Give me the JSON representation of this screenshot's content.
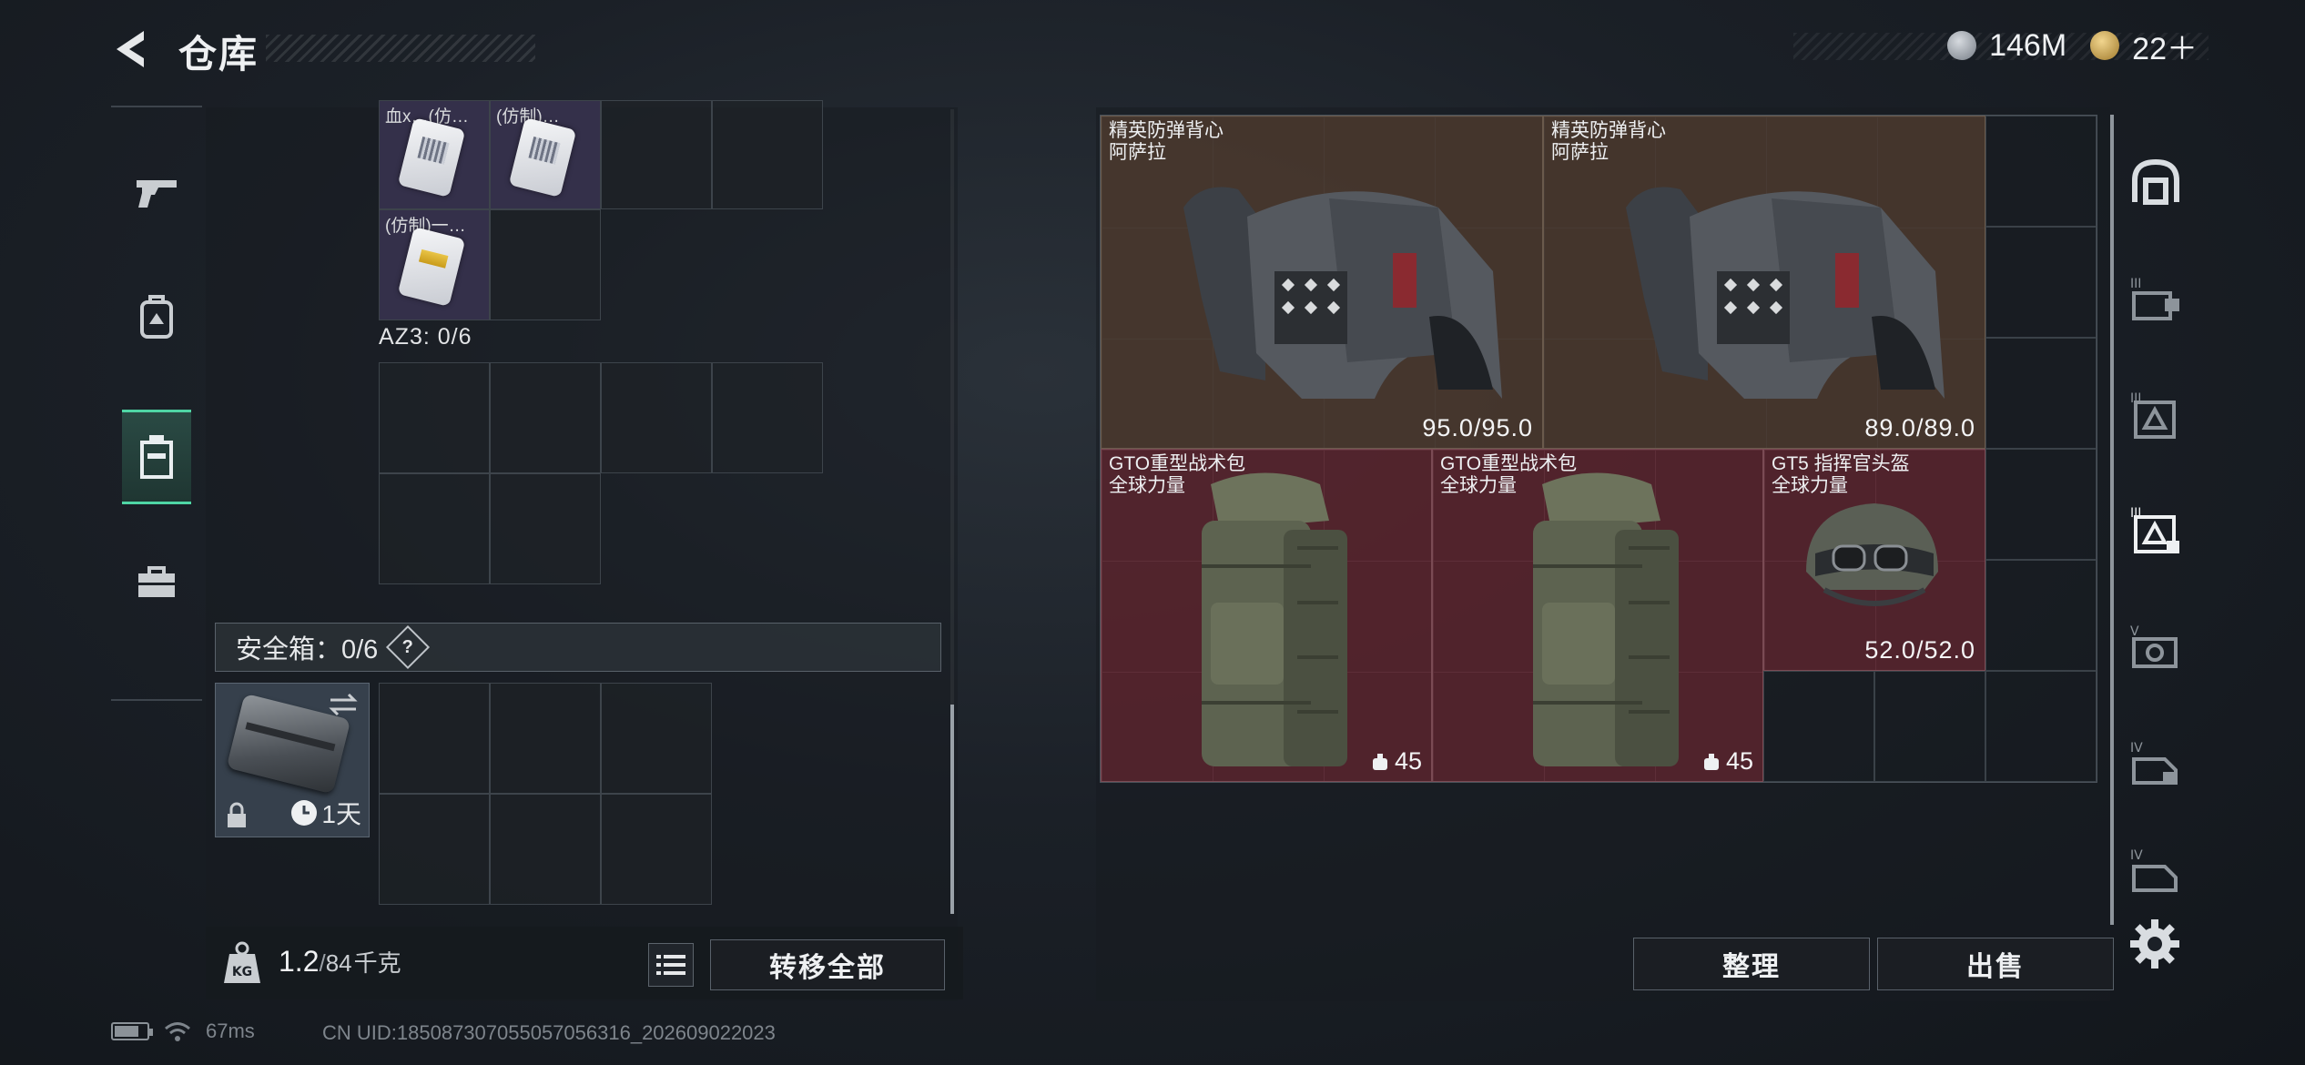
{
  "header": {
    "title": "仓库",
    "currency": [
      {
        "icon": "silver-coin-icon",
        "value": "146M"
      },
      {
        "icon": "gold-coin-icon",
        "value": "22＋"
      }
    ]
  },
  "left_nav": [
    "weapon-pistol-icon",
    "backpack-icon",
    "chest-rig-icon",
    "toolbox-icon"
  ],
  "backpack": {
    "top_items": [
      {
        "label": "血x…(仿…"
      },
      {
        "label": "(仿制)…"
      },
      {
        "label": "(仿制)一…"
      }
    ],
    "az3_label": "AZ3: 0/6",
    "safe_box_label": "安全箱：0/6",
    "help": "?",
    "safe_case_timer": "1天",
    "weight_current": "1.2",
    "weight_sep": "/",
    "weight_max": "84",
    "weight_unit": "千克",
    "kg_badge": "KG",
    "transfer_all": "转移全部"
  },
  "status_bar": {
    "ping": "67ms",
    "uid": "CN UID:1850873070550570563​16_202609022023"
  },
  "stash": {
    "items": [
      {
        "name": "精英防弹背心",
        "sub": "阿萨拉",
        "value": "95.0/95.0"
      },
      {
        "name": "精英防弹背心",
        "sub": "阿萨拉",
        "value": "89.0/89.0"
      },
      {
        "name": "GTO重型战术包",
        "sub": "全球力量",
        "value": "45"
      },
      {
        "name": "GTO重型战术包",
        "sub": "全球力量",
        "value": "45"
      },
      {
        "name": "GT5 指挥官头盔",
        "sub": "全球力量",
        "value": "52.0/52.0"
      }
    ],
    "sort": "整理",
    "sell": "出售"
  },
  "right_filters": [
    "helmet-filter-icon",
    "tier3-armor-filter-icon",
    "tier3-rig-filter-icon",
    "tier3-container-filter-icon",
    "tier5-filter-icon",
    "tier4-filter-icon",
    "tier4-misc-filter-icon"
  ],
  "colors": {
    "accent": "#4fd6a5",
    "brown_slot": "#4e3a2e",
    "red_slot": "#5a242e"
  }
}
